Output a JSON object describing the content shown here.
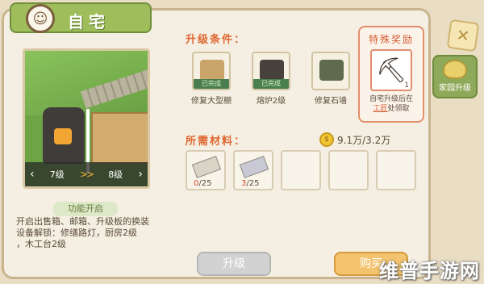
{
  "header": {
    "title": "自宅",
    "avatar_icon": "smiley-face-icon"
  },
  "preview": {
    "level_current": "7级",
    "level_next": "8级",
    "prev_icon": "chevron-left-icon",
    "next_icon": "chevron-right-icon",
    "mid_arrow": ">>"
  },
  "function": {
    "title": "功能开启",
    "lines": [
      "开启出售箱、邮箱、升级板的换装",
      "设备解锁：修缮路灯，厨房2级",
      "，木工台2级"
    ]
  },
  "conditions": {
    "heading": "升级条件：",
    "items": [
      {
        "label": "修复大型棚",
        "status": "已完成"
      },
      {
        "label": "熔炉2级",
        "status": "已完成"
      },
      {
        "label": "修复石墙",
        "status": ""
      }
    ]
  },
  "reward": {
    "title": "特殊奖励",
    "icon": "pickaxe-icon",
    "count": "1",
    "desc_line1": "自宅升级后在",
    "desc_hl": "工匠",
    "desc_rest": "处领取"
  },
  "materials": {
    "heading": "所需材料：",
    "coins": "9.1万/3.2万",
    "coin_icon": "coin-icon",
    "slots": [
      {
        "have": "0",
        "need": "/25"
      },
      {
        "have": "3",
        "need": "/25"
      },
      {
        "have": "",
        "need": ""
      },
      {
        "have": "",
        "need": ""
      },
      {
        "have": "",
        "need": ""
      }
    ]
  },
  "buttons": {
    "upgrade": "升级",
    "buy": "购买"
  },
  "side": {
    "tab_label": "家园升级",
    "close_icon": "close-icon"
  },
  "watermark": "维普手游网",
  "colors": {
    "accent": "#e0662f",
    "banner": "#9fbe5b",
    "error": "#e0452f"
  }
}
